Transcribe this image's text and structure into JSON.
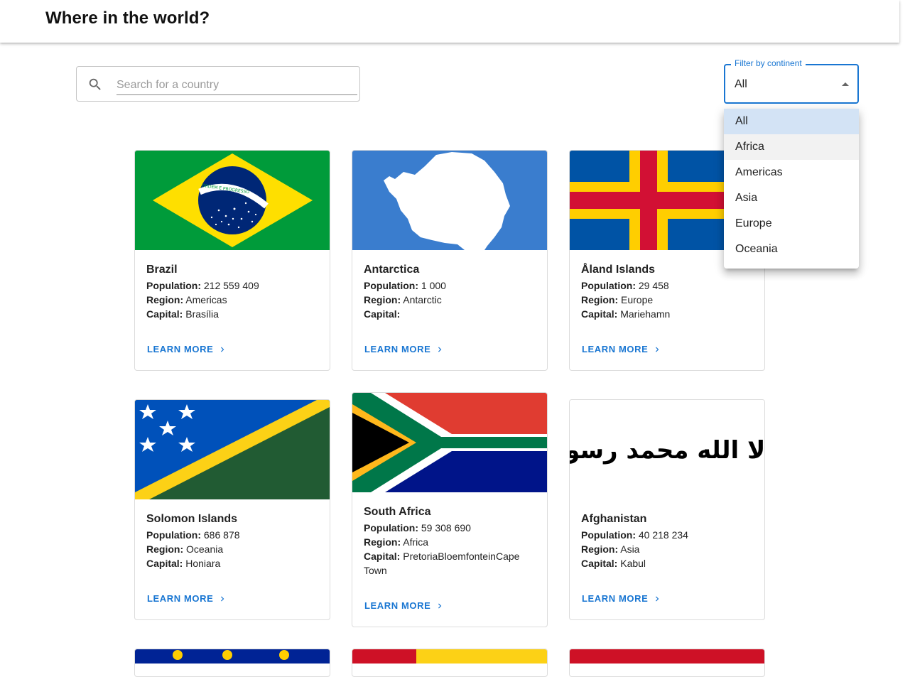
{
  "header": {
    "title": "Where in the world?"
  },
  "search": {
    "placeholder": "Search for a country",
    "value": ""
  },
  "filter": {
    "label": "Filter by continent",
    "value": "All",
    "options": [
      "All",
      "Africa",
      "Americas",
      "Asia",
      "Europe",
      "Oceania"
    ],
    "selected_index": 0,
    "hover_index": 1
  },
  "labels": {
    "population": "Population:",
    "region": "Region:",
    "capital": "Capital:",
    "learn_more": "LEARN MORE"
  },
  "countries": [
    {
      "name": "Brazil",
      "population": "212 559 409",
      "region": "Americas",
      "capital": "Brasília",
      "flag": "brazil-flag",
      "flag_text": "ORDEM E PROGRESSO"
    },
    {
      "name": "Antarctica",
      "population": "1 000",
      "region": "Antarctic",
      "capital": "",
      "flag": "antarctica-flag"
    },
    {
      "name": "Åland Islands",
      "population": "29 458",
      "region": "Europe",
      "capital": "Mariehamn",
      "flag": "aland-flag"
    },
    {
      "name": "Solomon Islands",
      "population": "686 878",
      "region": "Oceania",
      "capital": "Honiara",
      "flag": "solomon-islands-flag"
    },
    {
      "name": "South Africa",
      "population": "59 308 690",
      "region": "Africa",
      "capital": "PretoriaBloemfonteinCape Town",
      "flag": "south-africa-flag"
    },
    {
      "name": "Afghanistan",
      "population": "40 218 234",
      "region": "Asia",
      "capital": "Kabul",
      "flag": "afghanistan-flag",
      "flag_text": "لا إله إلا الله محمد رسول الله"
    }
  ],
  "colors": {
    "accent": "#1976d2",
    "menu_selected": "#d3e3f5"
  }
}
